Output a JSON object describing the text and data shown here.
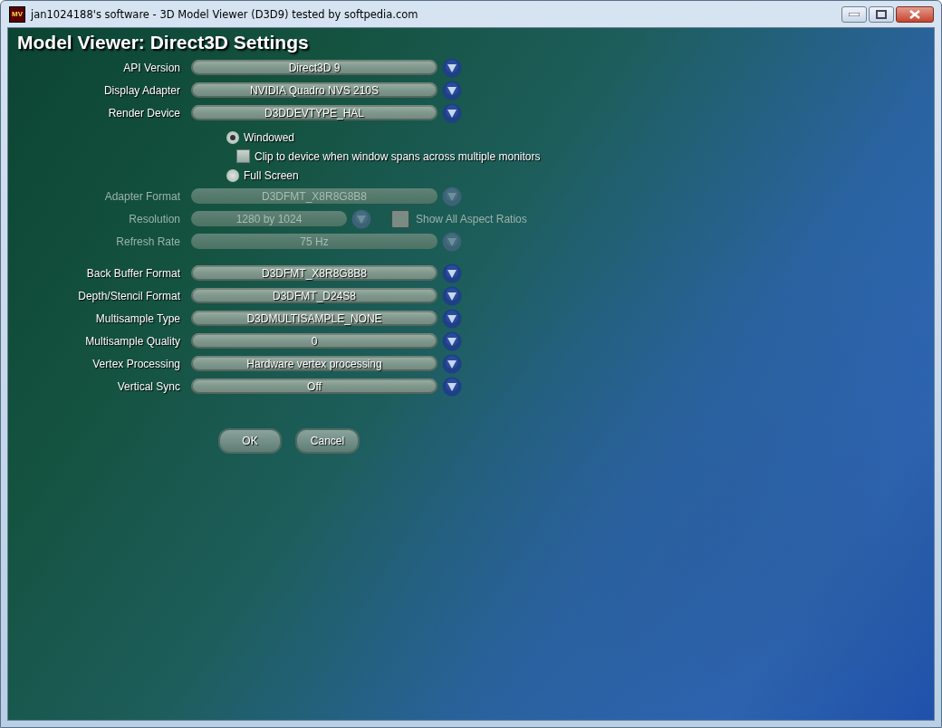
{
  "window": {
    "title": "jan1024188's software - 3D Model Viewer (D3D9) tested by softpedia.com",
    "app_icon": "MV"
  },
  "heading": "Model Viewer: Direct3D Settings",
  "device_settings": [
    {
      "label": "API Version",
      "value": "Direct3D 9",
      "disabled": false
    },
    {
      "label": "Display Adapter",
      "value": "NVIDIA Quadro NVS 210S",
      "disabled": false
    },
    {
      "label": "Render Device",
      "value": "D3DDEVTYPE_HAL",
      "disabled": false
    }
  ],
  "display_mode": [
    {
      "kind": "radio",
      "label": "Windowed",
      "selected": true
    },
    {
      "kind": "checkbox",
      "label": "Clip to device when window spans across multiple monitors",
      "checked": false
    },
    {
      "kind": "radio",
      "label": "Full Screen",
      "selected": false
    }
  ],
  "fullscreen_settings": [
    {
      "label": "Adapter Format",
      "value": "D3DFMT_X8R8G8B8",
      "disabled": true
    },
    {
      "label": "Resolution",
      "value": "1280 by 1024",
      "disabled": true,
      "option": {
        "label": "Show All Aspect Ratios",
        "checked": false
      }
    },
    {
      "label": "Refresh Rate",
      "value": "75 Hz",
      "disabled": true
    }
  ],
  "format_settings": [
    {
      "label": "Back Buffer Format",
      "value": "D3DFMT_X8R8G8B8",
      "disabled": false
    },
    {
      "label": "Depth/Stencil Format",
      "value": "D3DFMT_D24S8",
      "disabled": false
    },
    {
      "label": "Multisample Type",
      "value": "D3DMULTISAMPLE_NONE",
      "disabled": false
    },
    {
      "label": "Multisample Quality",
      "value": "0",
      "disabled": false
    },
    {
      "label": "Vertex Processing",
      "value": "Hardware vertex processing",
      "disabled": false
    },
    {
      "label": "Vertical Sync",
      "value": "Off",
      "disabled": false
    }
  ],
  "buttons": [
    "OK",
    "Cancel"
  ]
}
